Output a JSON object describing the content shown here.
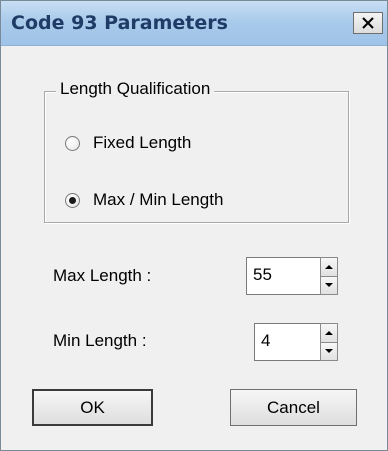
{
  "window": {
    "title": "Code 93 Parameters",
    "close_glyph": "✕"
  },
  "length_group": {
    "legend": "Length Qualification",
    "options": [
      {
        "label": "Fixed Length",
        "checked": false
      },
      {
        "label": "Max / Min Length",
        "checked": true
      }
    ]
  },
  "fields": {
    "max": {
      "label": "Max Length :",
      "value": "55"
    },
    "min": {
      "label": "Min Length :",
      "value": "4"
    }
  },
  "buttons": {
    "ok": "OK",
    "cancel": "Cancel"
  },
  "icons": {
    "close": "close-icon",
    "spin_up": "spin-up-icon",
    "spin_down": "spin-down-icon"
  },
  "colors": {
    "titlebar": "#a9cbeb",
    "title_text": "#1e3c66",
    "dialog_bg": "#f0f0f0"
  }
}
